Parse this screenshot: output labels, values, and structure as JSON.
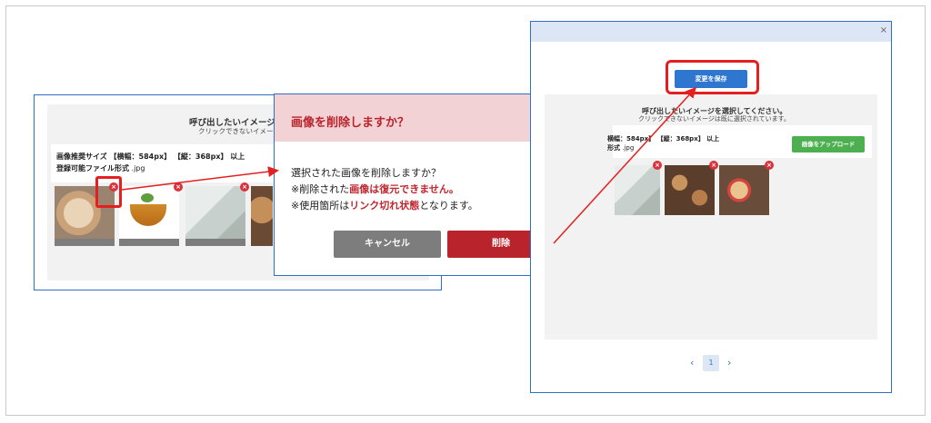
{
  "left_window": {
    "title": "呼び出したいイメージを選択し",
    "subtitle": "クリックできないイメージは既に選",
    "spec": "画像推奨サイズ 【横幅：584px】 【縦：368px】 以上",
    "format_label": "登録可能ファイル形式",
    "format_value": " .jpg"
  },
  "dialog": {
    "title": "画像を削除しますか？",
    "close": "×",
    "line1": "選択された画像を削除しますか？",
    "line2_pre": "※削除された",
    "line2_red": "画像は復元できません。",
    "line3_pre": "※使用箇所は",
    "line3_red": "リンク切れ状態",
    "line3_post": "となります。",
    "cancel_label": "キャンセル",
    "delete_label": "削除"
  },
  "right_window": {
    "close": "×",
    "save_label": "変更を保存",
    "title": "呼び出したいイメージを選択してください。",
    "subtitle": "クリックできないイメージは既に選択されています。",
    "spec": "横幅：584px】 【縦：368px】 以上",
    "format_label": "形式",
    "format_value": " .jpg",
    "upload_label": "画像をアップロード",
    "pager": {
      "prev": "‹",
      "page": "1",
      "next": "›"
    }
  },
  "thumb_delete_icon": "×",
  "colors": {
    "accent_red": "#b9232c",
    "primary_blue": "#2e76d0",
    "upload_green": "#4caf50",
    "highlight": "#e51f1f"
  }
}
